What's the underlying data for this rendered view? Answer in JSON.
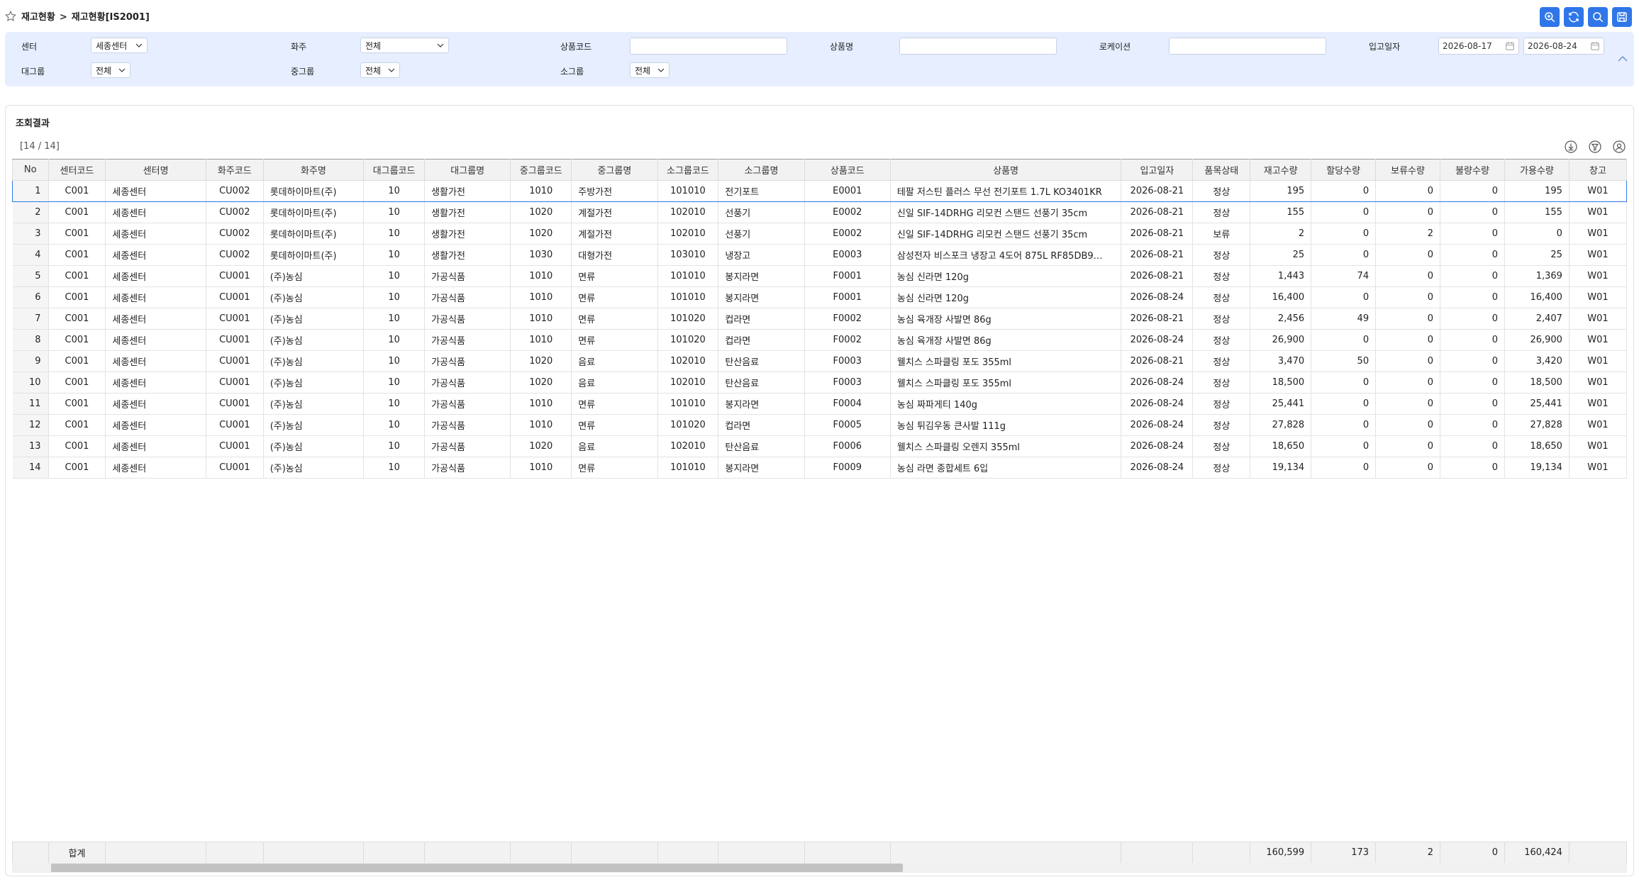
{
  "breadcrumb": {
    "parent": "재고현황",
    "separator": ">",
    "current": "재고현황[IS2001]"
  },
  "filters": {
    "center_label": "센터",
    "center_value": "세종센터",
    "owner_label": "화주",
    "owner_value": "전체",
    "product_code_label": "상품코드",
    "product_code_value": "",
    "product_name_label": "상품명",
    "product_name_value": "",
    "location_label": "로케이션",
    "location_value": "",
    "inbound_date_label": "입고일자",
    "date_from": "2026-08-17",
    "date_to": "2026-08-24",
    "large_group_label": "대그룹",
    "large_group_value": "전체",
    "mid_group_label": "중그룹",
    "mid_group_value": "전체",
    "small_group_label": "소그룹",
    "small_group_value": "전체"
  },
  "results": {
    "title": "조회결과",
    "count": "[14 / 14]",
    "columns": [
      "No",
      "센터코드",
      "센터명",
      "화주코드",
      "화주명",
      "대그룹코드",
      "대그룹명",
      "중그룹코드",
      "중그룹명",
      "소그룹코드",
      "소그룹명",
      "상품코드",
      "상품명",
      "입고일자",
      "품목상태",
      "재고수량",
      "할당수량",
      "보류수량",
      "불량수량",
      "가용수량",
      "창고"
    ],
    "rows": [
      [
        "1",
        "C001",
        "세종센터",
        "CU002",
        "롯데하이마트(주)",
        "10",
        "생활가전",
        "1010",
        "주방가전",
        "101010",
        "전기포트",
        "E0001",
        "테팔 저스틴 플러스 무선 전기포트 1.7L KO3401KR",
        "2026-08-21",
        "정상",
        "195",
        "0",
        "0",
        "0",
        "195",
        "W01"
      ],
      [
        "2",
        "C001",
        "세종센터",
        "CU002",
        "롯데하이마트(주)",
        "10",
        "생활가전",
        "1020",
        "계절가전",
        "102010",
        "선풍기",
        "E0002",
        "신일 SIF-14DRHG 리모컨 스탠드 선풍기 35cm",
        "2026-08-21",
        "정상",
        "155",
        "0",
        "0",
        "0",
        "155",
        "W01"
      ],
      [
        "3",
        "C001",
        "세종센터",
        "CU002",
        "롯데하이마트(주)",
        "10",
        "생활가전",
        "1020",
        "계절가전",
        "102010",
        "선풍기",
        "E0002",
        "신일 SIF-14DRHG 리모컨 스탠드 선풍기 35cm",
        "2026-08-21",
        "보류",
        "2",
        "0",
        "2",
        "0",
        "0",
        "W01"
      ],
      [
        "4",
        "C001",
        "세종센터",
        "CU002",
        "롯데하이마트(주)",
        "10",
        "생활가전",
        "1030",
        "대형가전",
        "103010",
        "냉장고",
        "E0003",
        "삼성전자 비스포크 냉장고 4도어 875L RF85DB9…",
        "2026-08-21",
        "정상",
        "25",
        "0",
        "0",
        "0",
        "25",
        "W01"
      ],
      [
        "5",
        "C001",
        "세종센터",
        "CU001",
        "(주)농심",
        "10",
        "가공식품",
        "1010",
        "면류",
        "101010",
        "봉지라면",
        "F0001",
        "농심 신라면 120g",
        "2026-08-21",
        "정상",
        "1,443",
        "74",
        "0",
        "0",
        "1,369",
        "W01"
      ],
      [
        "6",
        "C001",
        "세종센터",
        "CU001",
        "(주)농심",
        "10",
        "가공식품",
        "1010",
        "면류",
        "101010",
        "봉지라면",
        "F0001",
        "농심 신라면 120g",
        "2026-08-24",
        "정상",
        "16,400",
        "0",
        "0",
        "0",
        "16,400",
        "W01"
      ],
      [
        "7",
        "C001",
        "세종센터",
        "CU001",
        "(주)농심",
        "10",
        "가공식품",
        "1010",
        "면류",
        "101020",
        "컵라면",
        "F0002",
        "농심 육개장 사발면 86g",
        "2026-08-21",
        "정상",
        "2,456",
        "49",
        "0",
        "0",
        "2,407",
        "W01"
      ],
      [
        "8",
        "C001",
        "세종센터",
        "CU001",
        "(주)농심",
        "10",
        "가공식품",
        "1010",
        "면류",
        "101020",
        "컵라면",
        "F0002",
        "농심 육개장 사발면 86g",
        "2026-08-24",
        "정상",
        "26,900",
        "0",
        "0",
        "0",
        "26,900",
        "W01"
      ],
      [
        "9",
        "C001",
        "세종센터",
        "CU001",
        "(주)농심",
        "10",
        "가공식품",
        "1020",
        "음료",
        "102010",
        "탄산음료",
        "F0003",
        "웰치스 스파클링 포도 355ml",
        "2026-08-21",
        "정상",
        "3,470",
        "50",
        "0",
        "0",
        "3,420",
        "W01"
      ],
      [
        "10",
        "C001",
        "세종센터",
        "CU001",
        "(주)농심",
        "10",
        "가공식품",
        "1020",
        "음료",
        "102010",
        "탄산음료",
        "F0003",
        "웰치스 스파클링 포도 355ml",
        "2026-08-24",
        "정상",
        "18,500",
        "0",
        "0",
        "0",
        "18,500",
        "W01"
      ],
      [
        "11",
        "C001",
        "세종센터",
        "CU001",
        "(주)농심",
        "10",
        "가공식품",
        "1010",
        "면류",
        "101010",
        "봉지라면",
        "F0004",
        "농심 짜파게티 140g",
        "2026-08-24",
        "정상",
        "25,441",
        "0",
        "0",
        "0",
        "25,441",
        "W01"
      ],
      [
        "12",
        "C001",
        "세종센터",
        "CU001",
        "(주)농심",
        "10",
        "가공식품",
        "1010",
        "면류",
        "101020",
        "컵라면",
        "F0005",
        "농심 튀김우동 큰사발 111g",
        "2026-08-24",
        "정상",
        "27,828",
        "0",
        "0",
        "0",
        "27,828",
        "W01"
      ],
      [
        "13",
        "C001",
        "세종센터",
        "CU001",
        "(주)농심",
        "10",
        "가공식품",
        "1020",
        "음료",
        "102010",
        "탄산음료",
        "F0006",
        "웰치스 스파클링 오렌지 355ml",
        "2026-08-24",
        "정상",
        "18,650",
        "0",
        "0",
        "0",
        "18,650",
        "W01"
      ],
      [
        "14",
        "C001",
        "세종센터",
        "CU001",
        "(주)농심",
        "10",
        "가공식품",
        "1010",
        "면류",
        "101010",
        "봉지라면",
        "F0009",
        "농심 라면 종합세트 6입",
        "2026-08-24",
        "정상",
        "19,134",
        "0",
        "0",
        "0",
        "19,134",
        "W01"
      ]
    ],
    "totals": {
      "label": "합계",
      "stock": "160,599",
      "allocated": "173",
      "hold": "2",
      "defect": "0",
      "available": "160,424"
    }
  },
  "colors": {
    "accent": "#2f76e8",
    "filter_bg": "#e6eeff"
  },
  "icons": [
    "star-icon",
    "zoom-in-icon",
    "refresh-icon",
    "search-icon",
    "save-icon",
    "calendar-icon",
    "collapse-icon",
    "download-icon",
    "filter-icon",
    "settings-icon"
  ]
}
